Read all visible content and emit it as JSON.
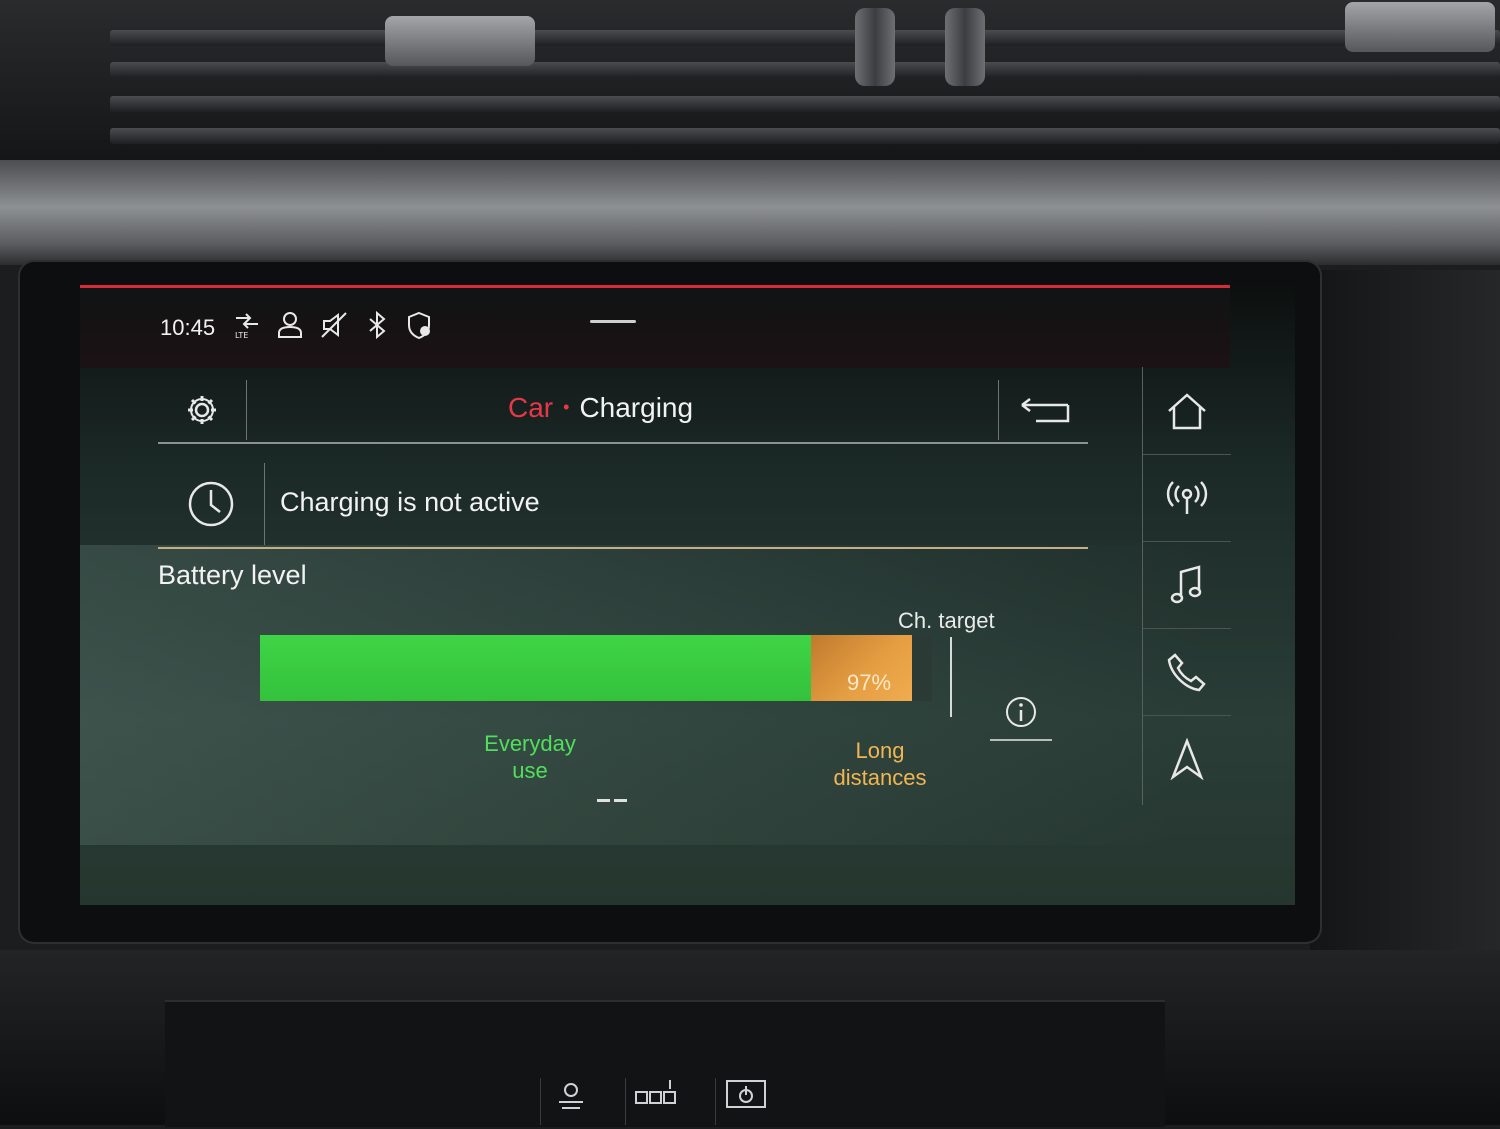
{
  "status_bar": {
    "time": "10:45",
    "icons": [
      "data-transfer-lte-icon",
      "user-profile-icon",
      "mute-icon",
      "bluetooth-icon",
      "location-service-icon"
    ]
  },
  "header": {
    "breadcrumb_parent": "Car",
    "breadcrumb_separator": "•",
    "breadcrumb_current": "Charging",
    "settings_icon": "gear-icon",
    "back_icon": "back-arrow-icon"
  },
  "charging_status": {
    "icon": "clock-icon",
    "text": "Charging is not active"
  },
  "battery": {
    "section_title": "Battery level",
    "level_fraction": 0.82,
    "charge_target_percent": 97,
    "charge_target_text": "97%",
    "target_label": "Ch. target",
    "legend_everyday": "Everyday use",
    "legend_long": "Long distances",
    "info_icon": "info-icon",
    "colors": {
      "everyday": "#3fd446",
      "long_distance": "#e59d42"
    }
  },
  "nav_rail": {
    "items": [
      "home-icon",
      "radio-icon",
      "music-icon",
      "phone-icon",
      "navigation-icon"
    ]
  },
  "console_buttons": [
    "climate-icon",
    "drive-select-icon",
    "power-icon"
  ]
}
